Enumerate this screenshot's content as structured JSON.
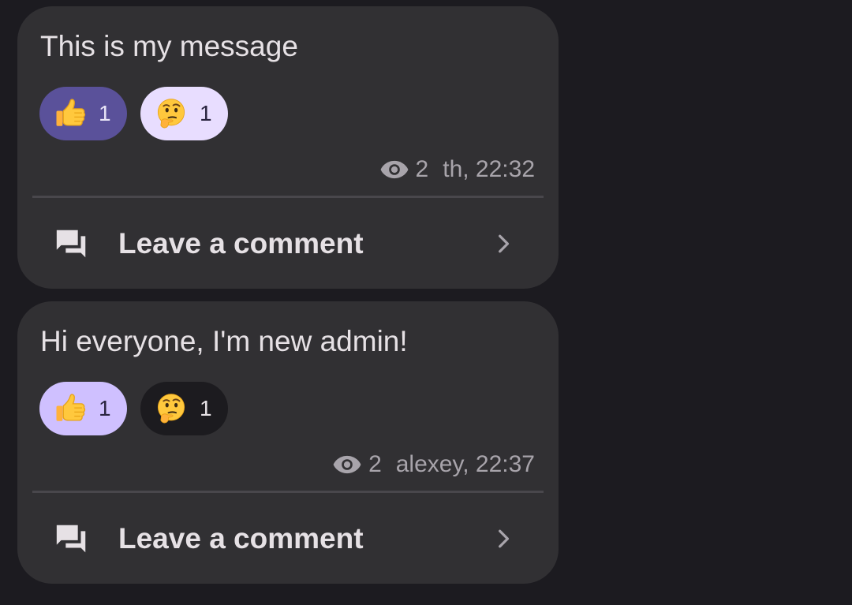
{
  "messages": [
    {
      "text": "This is my message",
      "reactions": [
        {
          "emoji": "thumbs-up",
          "count": "1",
          "style": "dark-purple"
        },
        {
          "emoji": "thinking-face",
          "count": "1",
          "style": "light-lavender"
        }
      ],
      "views": "2",
      "author_time": "th, 22:32",
      "comment_label": "Leave a comment"
    },
    {
      "text": "Hi everyone, I'm new admin!",
      "reactions": [
        {
          "emoji": "thumbs-up",
          "count": "1",
          "style": "lavender"
        },
        {
          "emoji": "thinking-face",
          "count": "1",
          "style": "black"
        }
      ],
      "views": "2",
      "author_time": "alexey, 22:37",
      "comment_label": "Leave a comment"
    }
  ],
  "colors": {
    "background": "#1c1b20",
    "card": "#313033",
    "accent_dark": "#5a519a",
    "accent_light": "#e8ddff"
  }
}
